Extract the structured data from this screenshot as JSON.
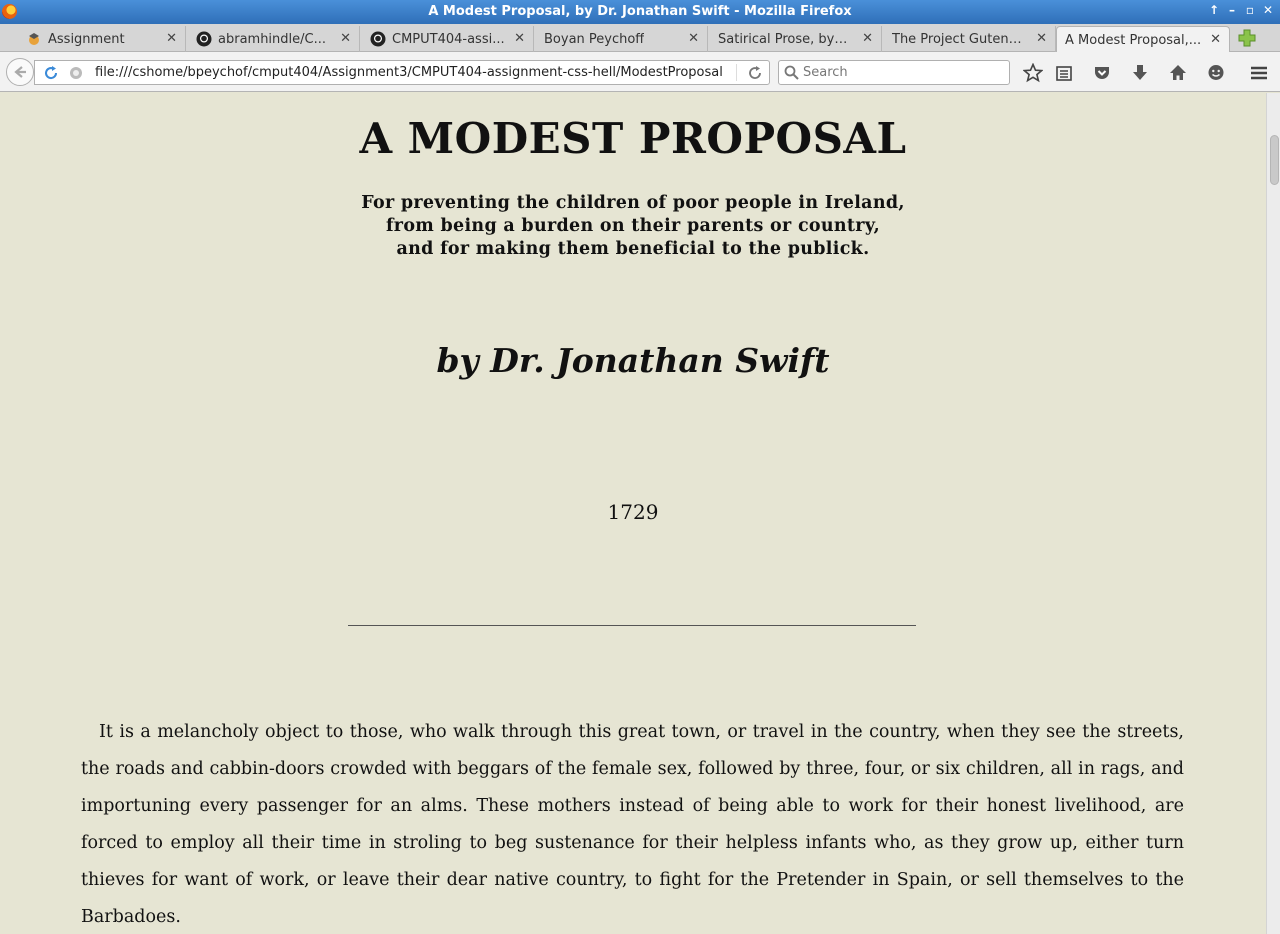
{
  "window": {
    "title": "A Modest Proposal, by Dr. Jonathan Swift - Mozilla Firefox"
  },
  "tabs": [
    {
      "label": "Assignment",
      "icon": "eclass-icon"
    },
    {
      "label": "abramhindle/C...",
      "icon": "github-icon"
    },
    {
      "label": "CMPUT404-assi...",
      "icon": "github-icon"
    },
    {
      "label": "Boyan Peychoff",
      "icon": "none"
    },
    {
      "label": "Satirical Prose, by ...",
      "icon": "none"
    },
    {
      "label": "The Project Gutenb...",
      "icon": "none"
    },
    {
      "label": "A Modest Proposal,...",
      "icon": "none",
      "active": true
    }
  ],
  "navbar": {
    "url": "file:///cshome/bpeychof/cmput404/Assignment3/CMPUT404-assignment-css-hell/ModestProposal",
    "search_placeholder": "Search"
  },
  "document": {
    "title": "A MODEST PROPOSAL",
    "subtitle_lines": [
      "For preventing the children of poor people in Ireland,",
      "from being a burden on their parents or country,",
      "and for making them beneficial to the publick."
    ],
    "author": "by Dr. Jonathan Swift",
    "year": "1729",
    "first_paragraph": "It is a melancholy object to those, who walk through this great town, or travel in the country, when they see the streets, the roads and cabbin-doors crowded with beggars of the female sex, followed by three, four, or six children, all in rags, and importuning every passenger for an alms. These mothers instead of being able to work for their honest livelihood, are forced to employ all their time in stroling to beg sustenance for their helpless infants who, as they grow up, either turn thieves for want of work, or leave their dear native country, to fight for the Pretender in Spain, or sell themselves to the Barbadoes."
  },
  "colors": {
    "page_background": "#e6e5d3",
    "titlebar": "#3b7fc8"
  }
}
